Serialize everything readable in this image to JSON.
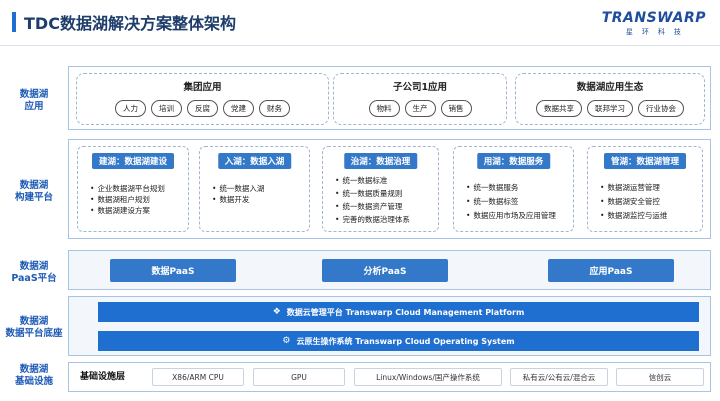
{
  "header": {
    "title": "TDC数据湖解决方案整体架构",
    "logo_main": "TRANSWARP",
    "logo_sub": "星环科技"
  },
  "row_labels": {
    "apps": "数据湖\n应用",
    "build": "数据湖\n构建平台",
    "paas": "数据湖\nPaaS平台",
    "base": "数据湖\n数据平台底座",
    "infra": "数据湖\n基础设施"
  },
  "app_groups": [
    {
      "title": "集团应用",
      "items": [
        "人力",
        "培训",
        "反腐",
        "党建",
        "财务"
      ]
    },
    {
      "title": "子公司1应用",
      "items": [
        "物料",
        "生产",
        "销售"
      ]
    },
    {
      "title": "数据湖应用生态",
      "items": [
        "数据共享",
        "联邦学习",
        "行业协会"
      ]
    }
  ],
  "build_groups": [
    {
      "header": "建湖：数据湖建设",
      "items": [
        "企业数据湖平台规划",
        "数据湖租户规划",
        "数据湖建设方案"
      ]
    },
    {
      "header": "入湖：数据入湖",
      "items": [
        "统一数据入湖",
        "数据开发"
      ]
    },
    {
      "header": "治湖：数据治理",
      "items": [
        "统一数据标准",
        "统一数据质量规则",
        "统一数据资产管理",
        "完善的数据治理体系"
      ]
    },
    {
      "header": "用湖：数据服务",
      "items": [
        "统一数据服务",
        "统一数据标签",
        "数据应用市场及应用管理"
      ]
    },
    {
      "header": "管湖：数据湖管理",
      "items": [
        "数据湖运营管理",
        "数据湖安全管控",
        "数据湖监控与运维"
      ]
    }
  ],
  "paas": [
    "数据PaaS",
    "分析PaaS",
    "应用PaaS"
  ],
  "base_bars": [
    {
      "icon": "cube-icon",
      "label": "数据云管理平台  Transwarp Cloud Management Platform"
    },
    {
      "icon": "gear-icon",
      "label": "云原生操作系统  Transwarp Cloud Operating System"
    }
  ],
  "infra": {
    "label": "基础设施层",
    "items": [
      "X86/ARM CPU",
      "GPU",
      "Linux/Windows/国产操作系统",
      "私有云/公有云/混合云",
      "信创云"
    ]
  }
}
